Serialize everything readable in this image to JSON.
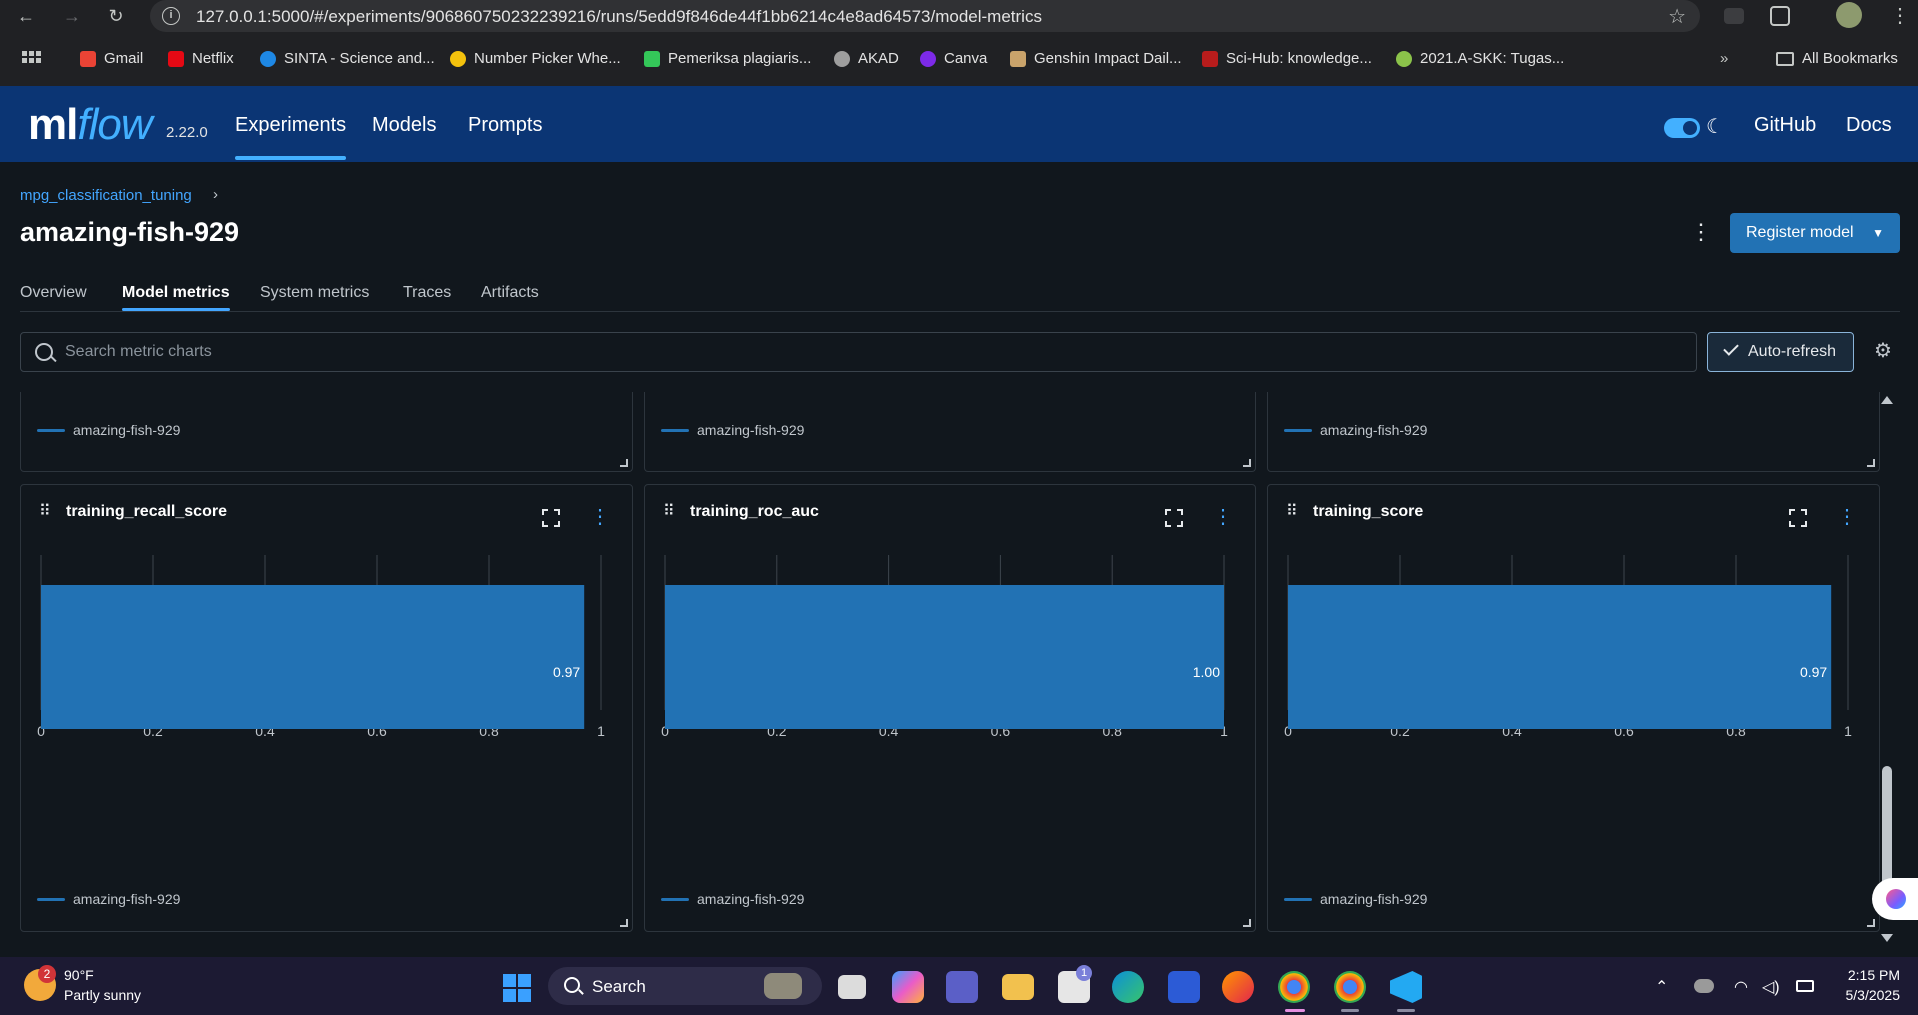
{
  "browser": {
    "url": "127.0.0.1:5000/#/experiments/906860750232239216/runs/5edd9f846de44f1bb6214c4e8ad64573/model-metrics",
    "bookmarks": [
      {
        "label": "Gmail",
        "color": "#ea4335"
      },
      {
        "label": "Netflix",
        "color": "#e50914"
      },
      {
        "label": "SINTA - Science and...",
        "color": "#1e88e5"
      },
      {
        "label": "Number Picker Whe...",
        "color": "#f4c20d"
      },
      {
        "label": "Pemeriksa plagiaris...",
        "color": "#34c759"
      },
      {
        "label": "AKAD",
        "color": "#9e9e9e"
      },
      {
        "label": "Canva",
        "color": "#7d2ae8"
      },
      {
        "label": "Genshin Impact Dail...",
        "color": "#c9a36b"
      },
      {
        "label": "Sci-Hub: knowledge...",
        "color": "#b71c1c"
      },
      {
        "label": "2021.A-SKK: Tugas...",
        "color": "#8bc34a"
      }
    ],
    "all_bookmarks": "All Bookmarks"
  },
  "header": {
    "logo_ml": "ml",
    "logo_flow": "flow",
    "version": "2.22.0",
    "nav": [
      "Experiments",
      "Models",
      "Prompts"
    ],
    "active_nav": "Experiments",
    "github": "GitHub",
    "docs": "Docs"
  },
  "run": {
    "breadcrumb": "mpg_classification_tuning",
    "breadcrumb_sep": "›",
    "title": "amazing-fish-929",
    "register_label": "Register model"
  },
  "tabs": [
    "Overview",
    "Model metrics",
    "System metrics",
    "Traces",
    "Artifacts"
  ],
  "active_tab": "Model metrics",
  "toolbar": {
    "search_placeholder": "Search metric charts",
    "autorefresh_label": "Auto-refresh"
  },
  "legend_label": "amazing-fish-929",
  "series_color": "#2272b4",
  "chart_data": [
    {
      "type": "bar",
      "title": "training_recall_score",
      "categories": [
        "amazing-fish-929"
      ],
      "values": [
        0.97
      ],
      "data_label": "0.97",
      "xlim": [
        0,
        1
      ],
      "xticks": [
        "0",
        "0.2",
        "0.4",
        "0.6",
        "0.8",
        "1"
      ],
      "orientation": "horizontal",
      "grid": true
    },
    {
      "type": "bar",
      "title": "training_roc_auc",
      "categories": [
        "amazing-fish-929"
      ],
      "values": [
        1.0
      ],
      "data_label": "1.00",
      "xlim": [
        0,
        1
      ],
      "xticks": [
        "0",
        "0.2",
        "0.4",
        "0.6",
        "0.8",
        "1"
      ],
      "orientation": "horizontal",
      "grid": true
    },
    {
      "type": "bar",
      "title": "training_score",
      "categories": [
        "amazing-fish-929"
      ],
      "values": [
        0.97
      ],
      "data_label": "0.97",
      "xlim": [
        0,
        1
      ],
      "xticks": [
        "0",
        "0.2",
        "0.4",
        "0.6",
        "0.8",
        "1"
      ],
      "orientation": "horizontal",
      "grid": true
    }
  ],
  "taskbar": {
    "weather_badge": "2",
    "temperature": "90°F",
    "weather": "Partly sunny",
    "search_label": "Search",
    "store_badge": "1",
    "time": "2:15 PM",
    "date": "5/3/2025"
  }
}
